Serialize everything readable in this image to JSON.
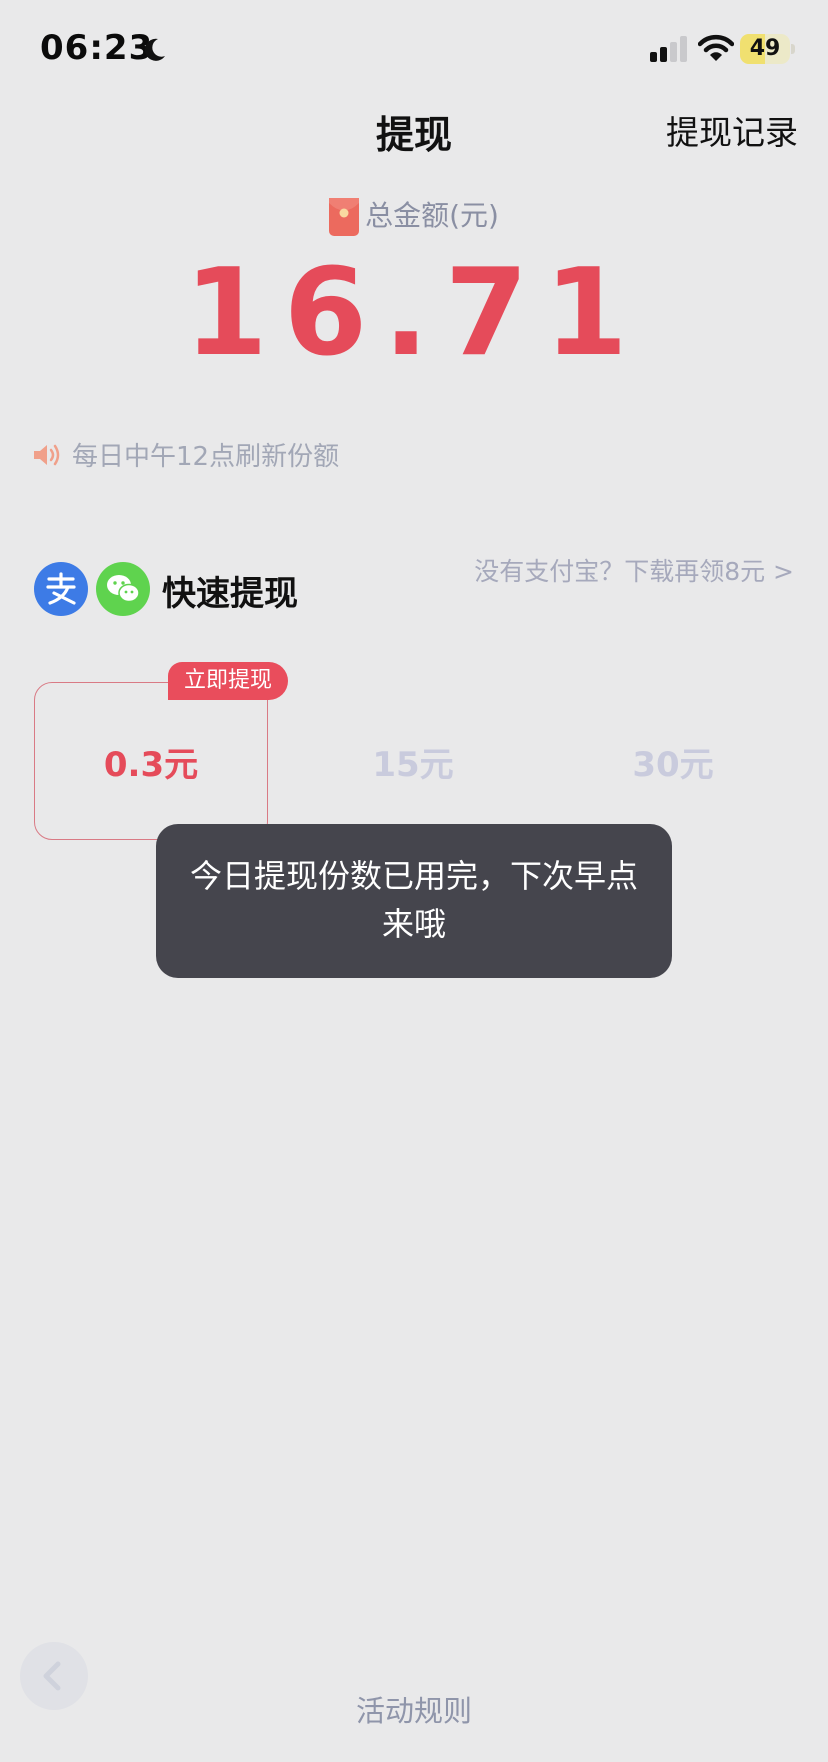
{
  "status_bar": {
    "time": "06:23",
    "battery_level": "49",
    "battery_fraction": 0.49,
    "icons": [
      "moon-icon",
      "cellular-signal-icon",
      "wifi-icon",
      "battery-icon"
    ]
  },
  "header": {
    "title": "提现",
    "records_label": "提现记录"
  },
  "balance": {
    "label": "总金额(元)",
    "amount": "16.71",
    "icon": "red-envelope-icon"
  },
  "notice": {
    "text": "每日中午12点刷新份额",
    "icon": "speaker-icon"
  },
  "quick_withdraw": {
    "title": "快速提现",
    "no_alipay_link": "没有支付宝？下载再领8元 >",
    "payment_icons": [
      "alipay-icon",
      "wechat-icon"
    ]
  },
  "amount_options": [
    {
      "label": "0.3元",
      "state": "selected"
    },
    {
      "label": "15元",
      "state": "disabled"
    },
    {
      "label": "30元",
      "state": "disabled"
    }
  ],
  "badge": {
    "label": "立即提现"
  },
  "toast": {
    "message": "今日提现份数已用完，下次早点来哦"
  },
  "footer": {
    "rules_label": "活动规则",
    "back_icon": "chevron-left-icon"
  },
  "colors": {
    "accent_red": "#e54b5a",
    "badge_red": "#e94d5c",
    "background": "#e9e9ea",
    "toast_bg": "#45454d",
    "alipay_blue": "#3d7be6",
    "wechat_green": "#5fd34e"
  }
}
